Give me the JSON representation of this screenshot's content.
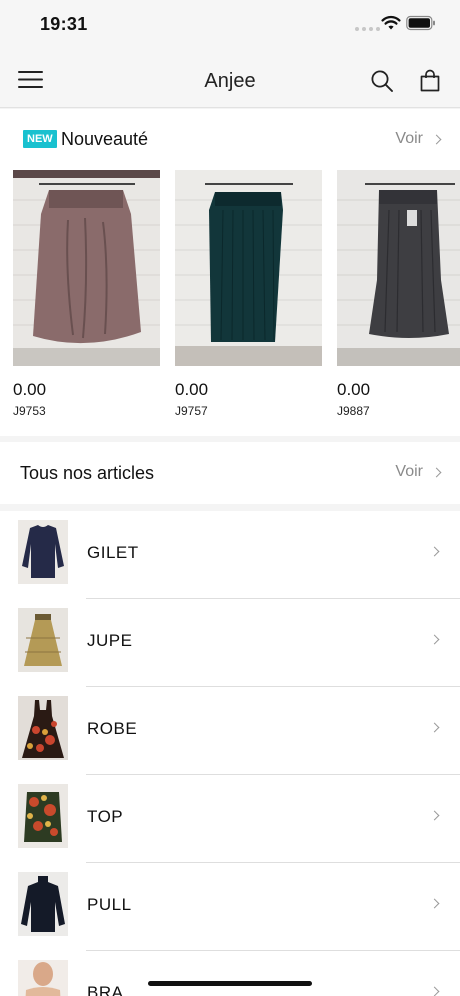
{
  "status_bar": {
    "time": "19:31"
  },
  "nav": {
    "title": "Anjee"
  },
  "new_arrivals": {
    "badge": "NEW",
    "title": "Nouveauté",
    "see_all": "Voir",
    "products": [
      {
        "price": "0.00",
        "sku": "J9753",
        "color": "#8a6b6b"
      },
      {
        "price": "0.00",
        "sku": "J9757",
        "color": "#12363a"
      },
      {
        "price": "0.00",
        "sku": "J9887",
        "color": "#3e3e42"
      }
    ]
  },
  "all_articles": {
    "title": "Tous nos articles",
    "see_all": "Voir"
  },
  "categories": [
    {
      "label": "GILET"
    },
    {
      "label": "JUPE"
    },
    {
      "label": "ROBE"
    },
    {
      "label": "TOP"
    },
    {
      "label": "PULL"
    },
    {
      "label": "BRA"
    }
  ],
  "colors": {
    "badge": "#19c1cf",
    "muted_text": "#8a8a8a",
    "divider": "#dedede",
    "background": "#f4f4f4"
  }
}
